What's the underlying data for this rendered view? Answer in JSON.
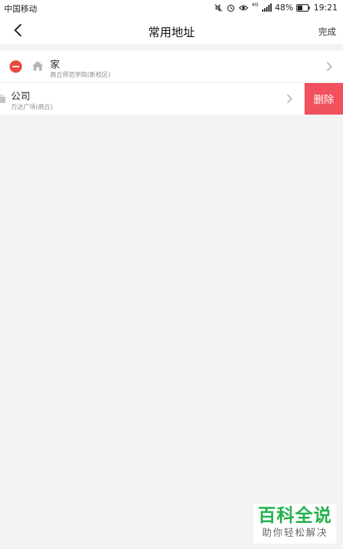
{
  "statusbar": {
    "carrier": "中国移动",
    "network": "4G",
    "battery": "48%",
    "battery_level": 0.48,
    "time": "19:21",
    "icons": [
      "mute-icon",
      "alarm-icon",
      "eye-comfort-icon",
      "signal-icon",
      "battery-icon"
    ]
  },
  "navbar": {
    "title": "常用地址",
    "done_label": "完成",
    "back_icon": "chevron-left-icon"
  },
  "addresses": [
    {
      "name": "家",
      "address": "商丘师范学院(新校区)",
      "icon": "home-icon",
      "colors": {
        "remove": "#e94a3f"
      }
    },
    {
      "name": "公司",
      "address": "万达广场(商丘)",
      "icon": "briefcase-icon",
      "delete_label": "删除",
      "colors": {
        "delete": "#f0515c"
      }
    }
  ],
  "watermark": {
    "title": "百科全说",
    "subtitle": "助你轻松解决",
    "color": "#23b24c"
  }
}
